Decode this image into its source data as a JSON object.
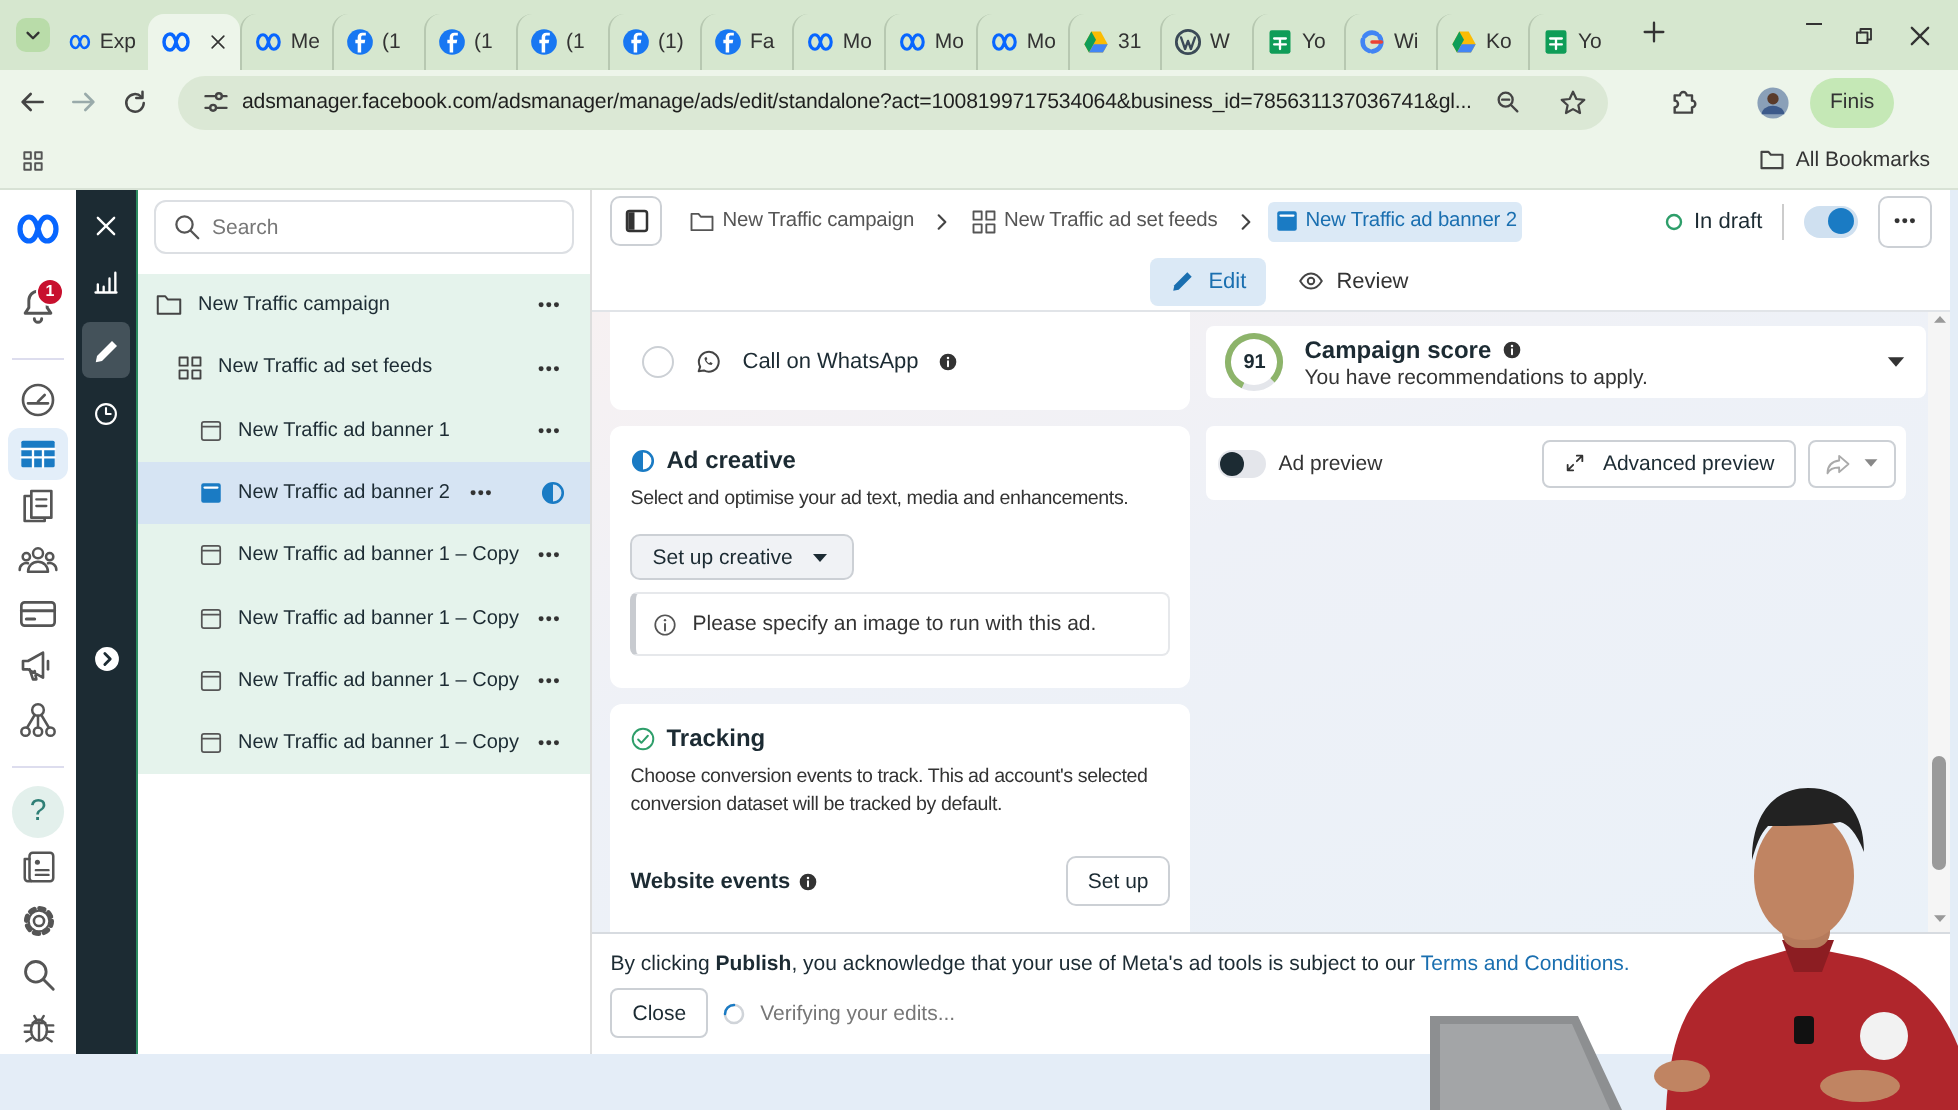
{
  "browser": {
    "tabs": [
      {
        "kind": "meta",
        "title": "Exp",
        "selected": false
      },
      {
        "kind": "meta",
        "selected": true
      },
      {
        "kind": "meta",
        "title": "Me",
        "selected": false
      },
      {
        "kind": "facebook",
        "title": "(1",
        "selected": false
      },
      {
        "kind": "facebook",
        "title": "(1",
        "selected": false
      },
      {
        "kind": "facebook",
        "title": "(1",
        "selected": false
      },
      {
        "kind": "facebook",
        "title": "(1)",
        "selected": false
      },
      {
        "kind": "facebook",
        "title": "Fa",
        "selected": false
      },
      {
        "kind": "meta",
        "title": "Mo",
        "selected": false
      },
      {
        "kind": "meta",
        "title": "Mo",
        "selected": false
      },
      {
        "kind": "meta",
        "title": "Mo",
        "selected": false
      },
      {
        "kind": "drive",
        "title": "31",
        "selected": false
      },
      {
        "kind": "wordpress",
        "title": "W",
        "selected": false
      },
      {
        "kind": "sheets",
        "title": "Yo",
        "selected": false
      },
      {
        "kind": "google",
        "title": "Wi",
        "selected": false
      },
      {
        "kind": "ads",
        "title": "Ko",
        "selected": false
      },
      {
        "kind": "sheets",
        "title": "Yo",
        "selected": false
      }
    ],
    "address": "adsmanager.facebook.com/adsmanager/manage/ads/edit/standalone?act=1008199717534064&business_id=785631137036741&gl...",
    "profile_button": "Finis",
    "bookmarks_folder": "All Bookmarks"
  },
  "nav_rail": {
    "groups": [
      [
        {
          "kind": "logo",
          "selected": false
        },
        {
          "kind": "bell",
          "selected": false,
          "badge": "1"
        }
      ],
      [
        {
          "kind": "gauge",
          "selected": false
        },
        {
          "kind": "table",
          "selected": true
        },
        {
          "kind": "pages",
          "selected": false
        },
        {
          "kind": "people",
          "selected": false
        },
        {
          "kind": "card",
          "selected": false
        },
        {
          "kind": "megaphone",
          "selected": false
        },
        {
          "kind": "hierarchy",
          "selected": false
        }
      ],
      [
        {
          "kind": "help",
          "label": "?",
          "selected": false
        },
        {
          "kind": "news",
          "selected": false
        },
        {
          "kind": "gear",
          "selected": false
        },
        {
          "kind": "search",
          "selected": false
        },
        {
          "kind": "bug",
          "selected": false
        }
      ]
    ]
  },
  "tool_strip": [
    {
      "kind": "close",
      "selected": false
    },
    {
      "kind": "chart",
      "selected": false
    },
    {
      "kind": "pencil",
      "selected": true
    },
    {
      "kind": "clock",
      "selected": false
    },
    {
      "kind": "expand",
      "selected": false
    }
  ],
  "tree": {
    "search_placeholder": "Search",
    "items": [
      {
        "kind": "campaign",
        "label": "New Traffic campaign",
        "selected": false,
        "incomplete": false,
        "children": [
          {
            "kind": "ad_set",
            "label": "New Traffic ad set feeds",
            "selected": false,
            "incomplete": false,
            "children": [
              {
                "kind": "ad",
                "label": "New Traffic ad banner 1",
                "selected": false,
                "incomplete": false
              },
              {
                "kind": "ad",
                "label": "New Traffic ad banner 2",
                "selected": true,
                "incomplete": true
              },
              {
                "kind": "ad",
                "label": "New Traffic ad banner 1 – Copy",
                "selected": false,
                "incomplete": false
              },
              {
                "kind": "ad",
                "label": "New Traffic ad banner 1 – Copy",
                "selected": false,
                "incomplete": false
              },
              {
                "kind": "ad",
                "label": "New Traffic ad banner 1 – Copy",
                "selected": false,
                "incomplete": false
              },
              {
                "kind": "ad",
                "label": "New Traffic ad banner 1 – Copy",
                "selected": false,
                "incomplete": false
              }
            ]
          }
        ]
      }
    ]
  },
  "breadcrumbs": [
    {
      "kind": "campaign",
      "label": "New Traffic campaign",
      "selected": false
    },
    {
      "kind": "ad_set",
      "label": "New Traffic ad set feeds",
      "selected": false
    },
    {
      "kind": "ad",
      "label": "New Traffic ad banner 2",
      "selected": true
    }
  ],
  "status": {
    "label": "In draft",
    "toggle_on": true
  },
  "mode_tabs": [
    {
      "kind": "edit",
      "label": "Edit",
      "selected": true
    },
    {
      "kind": "review",
      "label": "Review",
      "selected": false
    }
  ],
  "whatsapp_option": {
    "label": "Call on WhatsApp",
    "checked": false
  },
  "ad_creative": {
    "title": "Ad creative",
    "description": "Select and optimise your ad text, media and enhancements.",
    "button": "Set up creative",
    "notice": "Please specify an image to run with this ad."
  },
  "tracking": {
    "title": "Tracking",
    "description": "Choose conversion events to track. This ad account's selected conversion dataset will be tracked by default.",
    "website_events": "Website events",
    "button": "Set up"
  },
  "campaign_score": {
    "score": "91",
    "level": 0.8,
    "title": "Campaign score",
    "subtitle": "You have recommendations to apply."
  },
  "ad_preview": {
    "label": "Ad preview",
    "on": false,
    "button": "Advanced preview"
  },
  "footer": {
    "text": "By clicking **Publish**, you acknowledge that your use of Meta's ad tools is subject to our",
    "link": "Terms and Conditions.",
    "close_button": "Close",
    "progress": "Verifying your edits..."
  }
}
